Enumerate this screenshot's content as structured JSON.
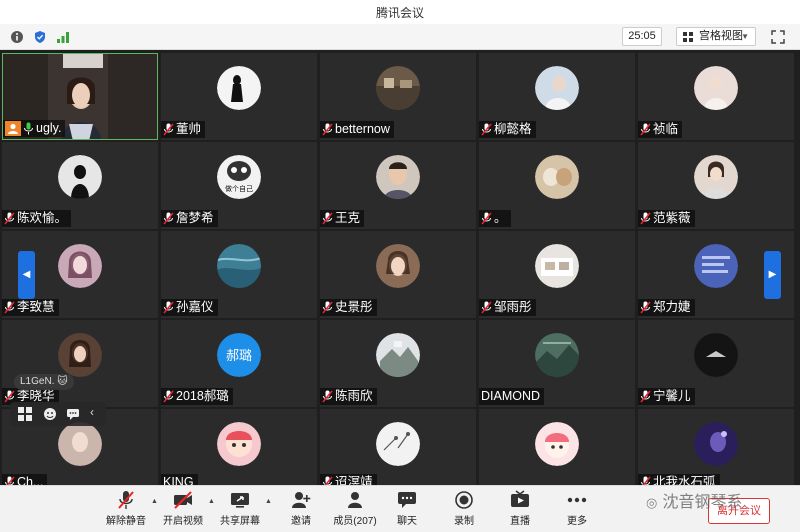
{
  "window": {
    "title": "腾讯会议"
  },
  "infobar": {
    "timer": "25:05",
    "view_label": "宫格视图"
  },
  "participants": [
    {
      "name": "ugly."
    },
    {
      "name": "董帅"
    },
    {
      "name": "betternow"
    },
    {
      "name": "柳懿格"
    },
    {
      "name": "祯临"
    },
    {
      "name": "陈欢愉。"
    },
    {
      "name": "詹梦希"
    },
    {
      "name": "王克"
    },
    {
      "name": "。"
    },
    {
      "name": "范紫薇"
    },
    {
      "name": "李致慧"
    },
    {
      "name": "孙嘉仪"
    },
    {
      "name": "史景彤"
    },
    {
      "name": "邹雨彤"
    },
    {
      "name": "郑力婕"
    },
    {
      "name": "李晓华"
    },
    {
      "name": "2018郝璐"
    },
    {
      "name": "陈雨欣"
    },
    {
      "name": "DIAMOND"
    },
    {
      "name": "宁馨儿"
    },
    {
      "name": "Ch..."
    },
    {
      "name": "KING"
    },
    {
      "name": "迢溟靖"
    },
    {
      "name": ""
    },
    {
      "name": "北我水石弧"
    }
  ],
  "avatar_text": {
    "hao_lu": "郝璐",
    "zhan_caption": "做个自己"
  },
  "floating": {
    "label": "L1GeN."
  },
  "toolbar": {
    "unmute": "解除静音",
    "start_video": "开启视频",
    "share_screen": "共享屏幕",
    "invite": "邀请",
    "members": "成员(207)",
    "chat": "聊天",
    "record": "录制",
    "live": "直播",
    "more": "更多",
    "leave": "离开会议"
  },
  "watermark": "沈音钢琴系",
  "colors": {
    "accent_blue": "#1e6fe0",
    "active_border": "#5cb85c",
    "leave_red": "#dd3333"
  }
}
